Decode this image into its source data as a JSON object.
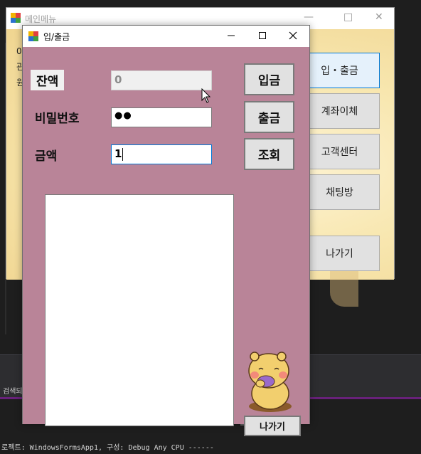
{
  "ide": {
    "output_text": "로젝트: WindowsFormsApp1, 구성: Debug Any CPU ------",
    "panel_label": "검색되"
  },
  "main_window": {
    "title": "메인메뉴",
    "left_labels": [
      "0",
      "관",
      "원"
    ],
    "menu_items": [
      {
        "label": "입・출금",
        "active": true
      },
      {
        "label": "계좌이체",
        "active": false
      },
      {
        "label": "고객센터",
        "active": false
      },
      {
        "label": "채팅방",
        "active": false
      },
      {
        "label": "나가기",
        "active": false
      }
    ]
  },
  "dialog": {
    "title": "입/출금",
    "balance_label": "잔액",
    "balance_value": "0",
    "password_label": "비밀번호",
    "password_value": "●●",
    "amount_label": "금액",
    "amount_value": "1",
    "deposit_button": "입금",
    "withdraw_button": "출금",
    "inquiry_button": "조회",
    "exit_button": "나가기"
  },
  "colors": {
    "dialog_bg": "#b98498",
    "ide_bg": "#1e1e1e",
    "accent": "#0078d7",
    "ide_purple": "#68217a"
  }
}
